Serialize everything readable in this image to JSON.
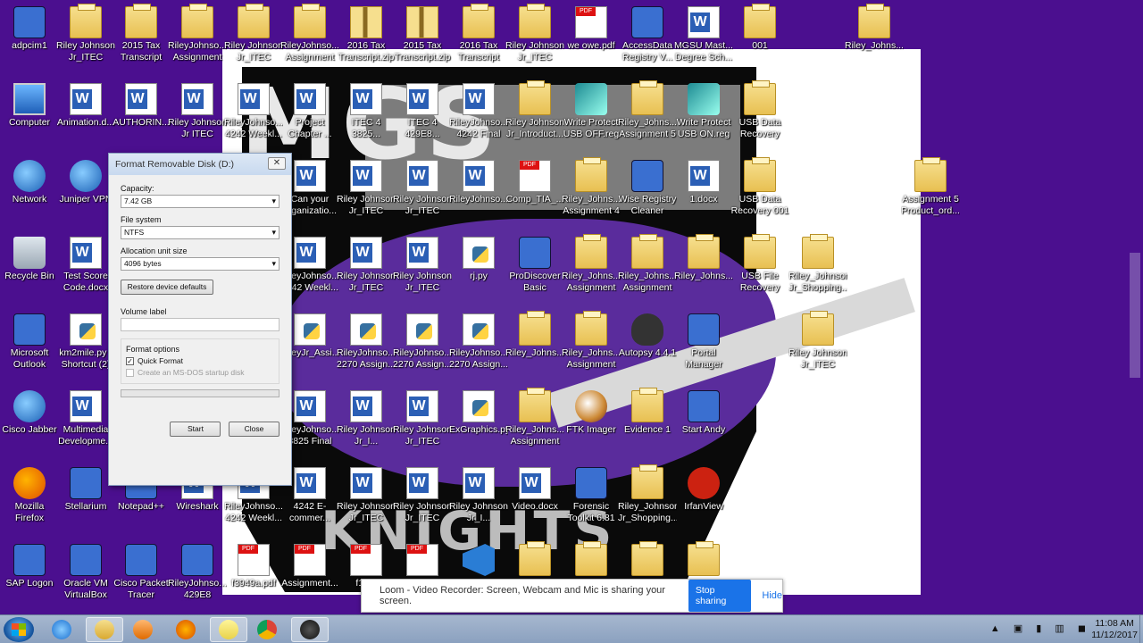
{
  "desktop": {
    "icons": [
      {
        "label": "adpcim1",
        "type": "app"
      },
      {
        "label": "Riley Johnson Jr_ITEC 3280...",
        "type": "folder"
      },
      {
        "label": "2015 Tax Transcript",
        "type": "folder"
      },
      {
        "label": "RileyJohnso... Assignment C...",
        "type": "folder"
      },
      {
        "label": "Riley Johnson Jr_ITEC 227...",
        "type": "folder"
      },
      {
        "label": "RileyJohnso... Assignment ...",
        "type": "folder"
      },
      {
        "label": "2016 Tax Transcript.zip",
        "type": "zip"
      },
      {
        "label": "2015 Tax Transcript.zip",
        "type": "zip"
      },
      {
        "label": "2016 Tax Transcript",
        "type": "folder"
      },
      {
        "label": "Riley Johnson Jr_ITEC 227...",
        "type": "folder"
      },
      {
        "label": "we owe.pdf",
        "type": "pdf"
      },
      {
        "label": "AccessData Registry V...",
        "type": "app"
      },
      {
        "label": "MGSU Mast... Degree Sch...",
        "type": "word"
      },
      {
        "label": "001",
        "type": "folder"
      },
      {
        "label": "Riley_Johns...",
        "type": "folder"
      },
      {
        "label": "Computer",
        "type": "computer"
      },
      {
        "label": "Animation.d...",
        "type": "word"
      },
      {
        "label": "AUTHORIN...",
        "type": "word"
      },
      {
        "label": "Riley Johnson Jr ITEC 4242...",
        "type": "word"
      },
      {
        "label": "RileyJohnso... 4242 Weekl...",
        "type": "word"
      },
      {
        "label": "Project Chapter ...",
        "type": "word"
      },
      {
        "label": "ITEC 4 3825...",
        "type": "word"
      },
      {
        "label": "ITEC 4 429E8...",
        "type": "word"
      },
      {
        "label": "RileyJohnso... 4242 Final P...",
        "type": "word"
      },
      {
        "label": "Riley Johnson Jr_Introduct...",
        "type": "folder"
      },
      {
        "label": "Write Protect USB OFF.reg",
        "type": "reg"
      },
      {
        "label": "Riley_Johns... Assignment 5",
        "type": "folder"
      },
      {
        "label": "Write Protect USB ON.reg",
        "type": "reg"
      },
      {
        "label": "USB Data Recovery",
        "type": "folder"
      },
      {
        "label": "Network",
        "type": "round"
      },
      {
        "label": "Juniper VPN",
        "type": "round"
      },
      {
        "label": "Can your organizatio...",
        "type": "word"
      },
      {
        "label": "Riley Johnson Jr_ITEC 332...",
        "type": "word"
      },
      {
        "label": "Riley Johnson Jr_ITEC 227...",
        "type": "word"
      },
      {
        "label": "RileyJohnso...",
        "type": "word"
      },
      {
        "label": "Comp_TIA_...",
        "type": "pdf"
      },
      {
        "label": "Riley_Johns... Assignment 4",
        "type": "folder"
      },
      {
        "label": "Wise Registry Cleaner",
        "type": "app"
      },
      {
        "label": "1.docx",
        "type": "word"
      },
      {
        "label": "USB Data Recovery 001",
        "type": "folder"
      },
      {
        "label": "Assignment 5 Product_ord...",
        "type": "folder"
      },
      {
        "label": "Recycle Bin",
        "type": "bin"
      },
      {
        "label": "Test Score Code.docx",
        "type": "word"
      },
      {
        "label": "RileyJohnso... 4242 Weekl...",
        "type": "word"
      },
      {
        "label": "Riley Johnson Jr_ITEC 428...",
        "type": "word"
      },
      {
        "label": "Riley Johnson Jr_ITEC 332...",
        "type": "word"
      },
      {
        "label": "rj.py",
        "type": "py"
      },
      {
        "label": "ProDiscover Basic",
        "type": "app"
      },
      {
        "label": "Riley_Johns... Assignment ...",
        "type": "folder"
      },
      {
        "label": "Riley_Johns... Assignment ...",
        "type": "folder"
      },
      {
        "label": "Riley_Johns...",
        "type": "folder"
      },
      {
        "label": "USB File Recovery",
        "type": "folder"
      },
      {
        "label": "Riley_Johnson Jr_Shopping...",
        "type": "folder"
      },
      {
        "label": "Microsoft Outlook",
        "type": "app"
      },
      {
        "label": "km2mile.py - Shortcut (2)",
        "type": "py"
      },
      {
        "label": "RileyJr_Assi...",
        "type": "py"
      },
      {
        "label": "RileyJohnso... 2270 Assign...",
        "type": "py"
      },
      {
        "label": "RileyJohnso... 2270 Assign...",
        "type": "py"
      },
      {
        "label": "RileyJohnso... 2270 Assign...",
        "type": "py"
      },
      {
        "label": "Riley_Johns...",
        "type": "folder"
      },
      {
        "label": "Riley_Johns... Assignment ...",
        "type": "folder"
      },
      {
        "label": "Autopsy 4.4.1",
        "type": "dog"
      },
      {
        "label": "Portal Manager",
        "type": "app"
      },
      {
        "label": "Riley Johnson Jr_ITEC 3280...",
        "type": "folder"
      },
      {
        "label": "Cisco Jabber",
        "type": "round"
      },
      {
        "label": "Multimedia Developme...",
        "type": "word"
      },
      {
        "label": "RileyJohnso... 3825 Final P...",
        "type": "word"
      },
      {
        "label": "Riley Johnson Jr_I...",
        "type": "word"
      },
      {
        "label": "Riley Johnson Jr_ITEC 332...",
        "type": "word"
      },
      {
        "label": "ExGraphics.py",
        "type": "py"
      },
      {
        "label": "Riley_Johns... Assignment ...",
        "type": "folder"
      },
      {
        "label": "FTK Imager",
        "type": "mag"
      },
      {
        "label": "Evidence 1",
        "type": "folder"
      },
      {
        "label": "Start Andy",
        "type": "app"
      },
      {
        "label": "Mozilla Firefox",
        "type": "fox"
      },
      {
        "label": "Stellarium",
        "type": "app"
      },
      {
        "label": "Notepad++",
        "type": "app"
      },
      {
        "label": "Wireshark",
        "type": "word"
      },
      {
        "label": "RileyJohnso... 4242 Weekl...",
        "type": "word"
      },
      {
        "label": "4242 E-commer...",
        "type": "word"
      },
      {
        "label": "Riley Johnson Jr_ITEC 227...",
        "type": "word"
      },
      {
        "label": "Riley Johnson Jr_ITEC 332...",
        "type": "word"
      },
      {
        "label": "Riley Johnson Jr_I...",
        "type": "word"
      },
      {
        "label": "Video.docx",
        "type": "word"
      },
      {
        "label": "Forensic Toolkit 6.81",
        "type": "app"
      },
      {
        "label": "Riley_Johnson Jr_Shopping...",
        "type": "folder"
      },
      {
        "label": "IrfanView",
        "type": "red"
      },
      {
        "label": "SAP Logon",
        "type": "app"
      },
      {
        "label": "Oracle VM VirtualBox",
        "type": "app"
      },
      {
        "label": "Cisco Packet Tracer",
        "type": "app"
      },
      {
        "label": "RileyJohnso... 429E8 Week...",
        "type": "app"
      },
      {
        "label": "f3949a.pdf",
        "type": "pdf"
      },
      {
        "label": "Assignment...",
        "type": "pdf"
      },
      {
        "label": "f14...",
        "type": "pdf"
      },
      {
        "label": "",
        "type": "pdf"
      },
      {
        "label": "",
        "type": "vs"
      },
      {
        "label": "",
        "type": "folder"
      },
      {
        "label": "",
        "type": "folder"
      },
      {
        "label": "",
        "type": "folder"
      },
      {
        "label": "",
        "type": "folder"
      }
    ]
  },
  "wallpaper": {
    "top_text": "MGS",
    "bottom_text": "KNIGHTS"
  },
  "format_dialog": {
    "title": "Format Removable Disk (D:)",
    "close_glyph": "✕",
    "capacity_label": "Capacity:",
    "capacity_value": "7.42 GB",
    "filesystem_label": "File system",
    "filesystem_value": "NTFS",
    "alloc_label": "Allocation unit size",
    "alloc_value": "4096 bytes",
    "restore_button": "Restore device defaults",
    "volume_label": "Volume label",
    "volume_value": "",
    "format_options_label": "Format options",
    "quick_format_label": "Quick Format",
    "quick_format_checked": true,
    "msdos_label": "Create an MS-DOS startup disk",
    "msdos_checked": false,
    "start_button": "Start",
    "close_button": "Close"
  },
  "loom_bar": {
    "message": "Loom - Video Recorder: Screen, Webcam and Mic is sharing your screen.",
    "stop_button": "Stop sharing",
    "hide_link": "Hide"
  },
  "taskbar": {
    "apps": [
      {
        "name": "internet-explorer-icon",
        "active": false
      },
      {
        "name": "file-explorer-icon",
        "active": true
      },
      {
        "name": "media-player-icon",
        "active": false
      },
      {
        "name": "firefox-icon",
        "active": false
      },
      {
        "name": "sticky-notes-icon",
        "active": true
      },
      {
        "name": "chrome-icon",
        "active": false
      },
      {
        "name": "autopsy-icon",
        "active": true
      }
    ],
    "tray_icons": "▲ ▣ ▮ ▥ ◼",
    "time": "11:08 AM",
    "date": "11/12/2017"
  },
  "colors": {
    "desktop_bg": "#4b0f8f",
    "accent": "#1a73e8"
  }
}
